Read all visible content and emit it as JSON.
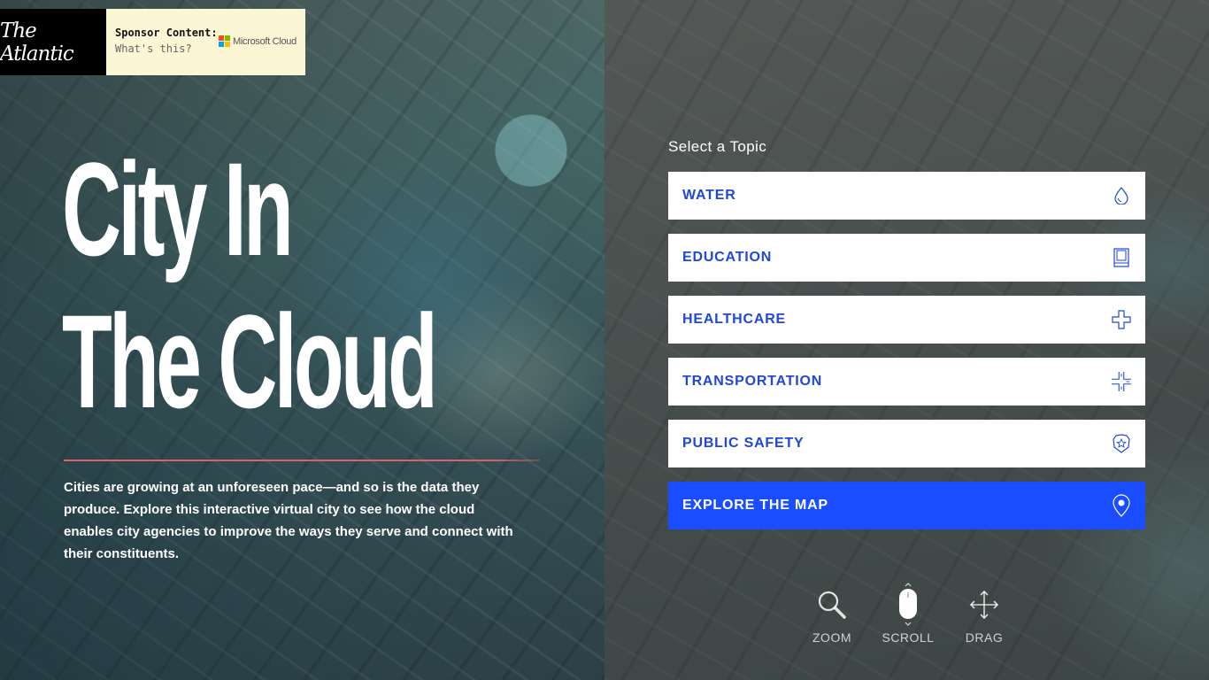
{
  "header": {
    "logo_text": "The Atlantic",
    "sponsor_label": "Sponsor Content:",
    "sponsor_help": "What's this?",
    "sponsor_brand": "Microsoft Cloud"
  },
  "hero": {
    "title_line1": "City In",
    "title_line2": "The Cloud",
    "description": "Cities are growing at an unforeseen pace—and so is the data they produce. Explore this interactive virtual city to see how the cloud enables city agencies to improve the ways they serve and connect with their constituents."
  },
  "topics": {
    "heading": "Select a Topic",
    "items": [
      {
        "label": "WATER",
        "icon": "water-drop-icon"
      },
      {
        "label": "EDUCATION",
        "icon": "book-icon"
      },
      {
        "label": "HEALTHCARE",
        "icon": "medical-cross-icon"
      },
      {
        "label": "TRANSPORTATION",
        "icon": "road-intersection-icon"
      },
      {
        "label": "PUBLIC SAFETY",
        "icon": "police-badge-icon"
      },
      {
        "label": "EXPLORE THE MAP",
        "icon": "map-pin-icon"
      }
    ]
  },
  "controls": {
    "zoom": "ZOOM",
    "scroll": "SCROLL",
    "drag": "DRAG"
  },
  "colors": {
    "accent_blue": "#1a4dff",
    "topic_text": "#1f47d8",
    "sponsor_bg": "#fbf6d4",
    "rule": "#e05e6a"
  }
}
